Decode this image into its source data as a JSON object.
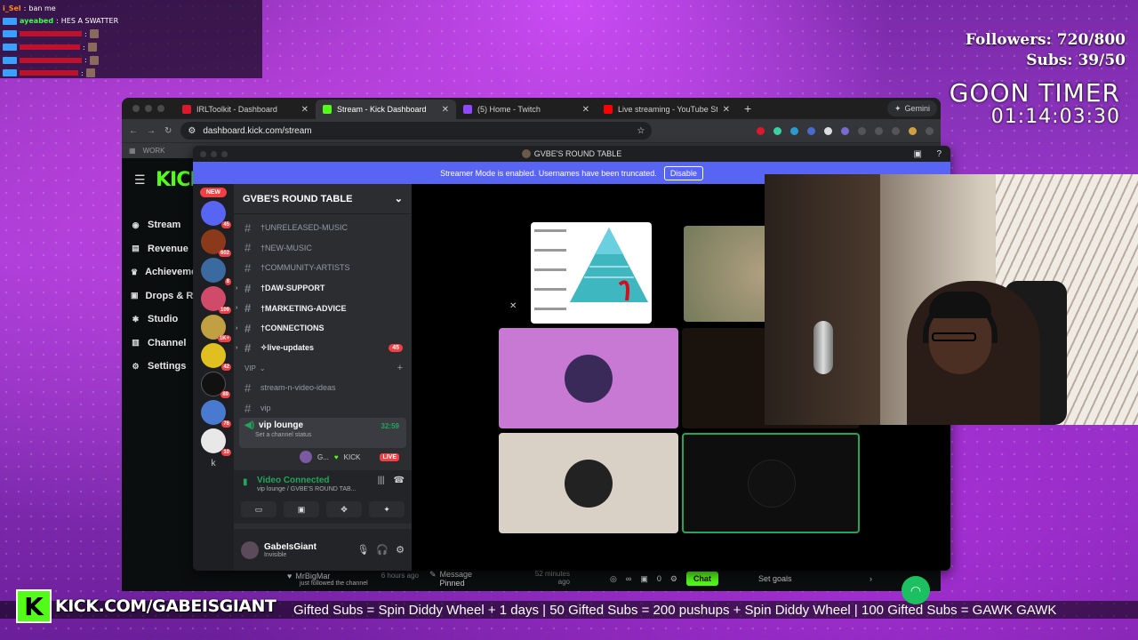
{
  "chat": [
    {
      "user": "i_Sel",
      "msg": "ban me",
      "color": "#ff8a1a"
    },
    {
      "user": "ayeabed",
      "msg": "HES A SWATTER",
      "color": "#3bff4a"
    },
    {
      "user": "",
      "msg": "",
      "color": "#e0162b"
    },
    {
      "user": "",
      "msg": "",
      "color": "#e0162b"
    },
    {
      "user": "",
      "msg": "",
      "color": "#e0162b"
    },
    {
      "user": "",
      "msg": "",
      "color": "#e0162b"
    }
  ],
  "stats": {
    "followers": "Followers: 720/800",
    "subs": "Subs: 39/50"
  },
  "goon": {
    "label": "GOON TIMER",
    "time": "01:14:03:30"
  },
  "browser": {
    "tabs": [
      {
        "label": "IRLToolkit - Dashboard",
        "color": "#e0162b"
      },
      {
        "label": "Stream - Kick Dashboard",
        "color": "#53fc18"
      },
      {
        "label": "(5) Home - Twitch",
        "color": "#9146ff"
      },
      {
        "label": "Live streaming - YouTube Stu",
        "color": "#ff0000"
      }
    ],
    "gemini": "Gemini",
    "url": "dashboard.kick.com/stream",
    "bookmark": "WORK"
  },
  "kick": {
    "logo": "KICK",
    "nav": [
      "Stream",
      "Revenue",
      "Achievements",
      "Drops & Rewards",
      "Studio",
      "Channel",
      "Settings"
    ],
    "bottom": {
      "follow_user": "MrBigMar",
      "follow_msg": "just followed the channel",
      "follow_time": "6 hours ago",
      "pinned": "Message Pinned",
      "pinned_time": "52 minutes ago",
      "viewers": "∞",
      "count": "0",
      "chat_btn": "Chat",
      "goals": "Set goals"
    }
  },
  "discord": {
    "window_title": "GVBE'S ROUND TABLE",
    "banner": "Streamer Mode is enabled. Usernames have been truncated.",
    "banner_btn": "Disable",
    "new": "NEW",
    "server_name": "GVBE'S ROUND TABLE",
    "servers": [
      {
        "count": "45",
        "color": "#5865f2"
      },
      {
        "count": "602",
        "color": "#8a3a1a"
      },
      {
        "count": "8",
        "color": "#3a6aa0"
      },
      {
        "count": "109",
        "color": "#d04a6a"
      },
      {
        "count": "1K+",
        "color": "#c0a040"
      },
      {
        "count": "42",
        "color": "#e0c020"
      },
      {
        "count": "89",
        "color": "#111111"
      },
      {
        "count": "76",
        "color": "#4a7ad0"
      },
      {
        "count": "10",
        "color": "#e8e8e8"
      }
    ],
    "server_k": "k",
    "channels": [
      {
        "name": "†UNRELEASED-MUSIC",
        "bold": false
      },
      {
        "name": "†NEW-MUSIC",
        "bold": false
      },
      {
        "name": "†COMMUNITY-ARTISTS",
        "bold": false
      },
      {
        "name": "†DAW-SUPPORT",
        "bold": true
      },
      {
        "name": "†MARKETING-ADVICE",
        "bold": true
      },
      {
        "name": "†CONNECTIONS",
        "bold": true
      },
      {
        "name": "✧live-updates",
        "bold": true,
        "count": "45"
      }
    ],
    "vip_cat": "VIP",
    "vip_channels": [
      "stream-n-video-ideas",
      "vip"
    ],
    "voice": {
      "name": "vip lounge",
      "time": "32:59",
      "status": "Set a channel status"
    },
    "voice_user": {
      "name": "G...",
      "tag": "KICK",
      "live": "LIVE"
    },
    "vc": {
      "title": "Video Connected",
      "sub": "vip lounge / GVBE'S ROUND TAB..."
    },
    "user": {
      "name": "GabeIsGiant",
      "status": "Invisible"
    }
  },
  "overlay": {
    "kick_url": "KICK.COM/GABEISGIANT",
    "ticker": "Gifted Subs = Spin Diddy Wheel + 1 days   |   50 Gifted Subs = 200 pushups + Spin Diddy Wheel   |   100 Gifted Subs = GAWK GAWK"
  }
}
